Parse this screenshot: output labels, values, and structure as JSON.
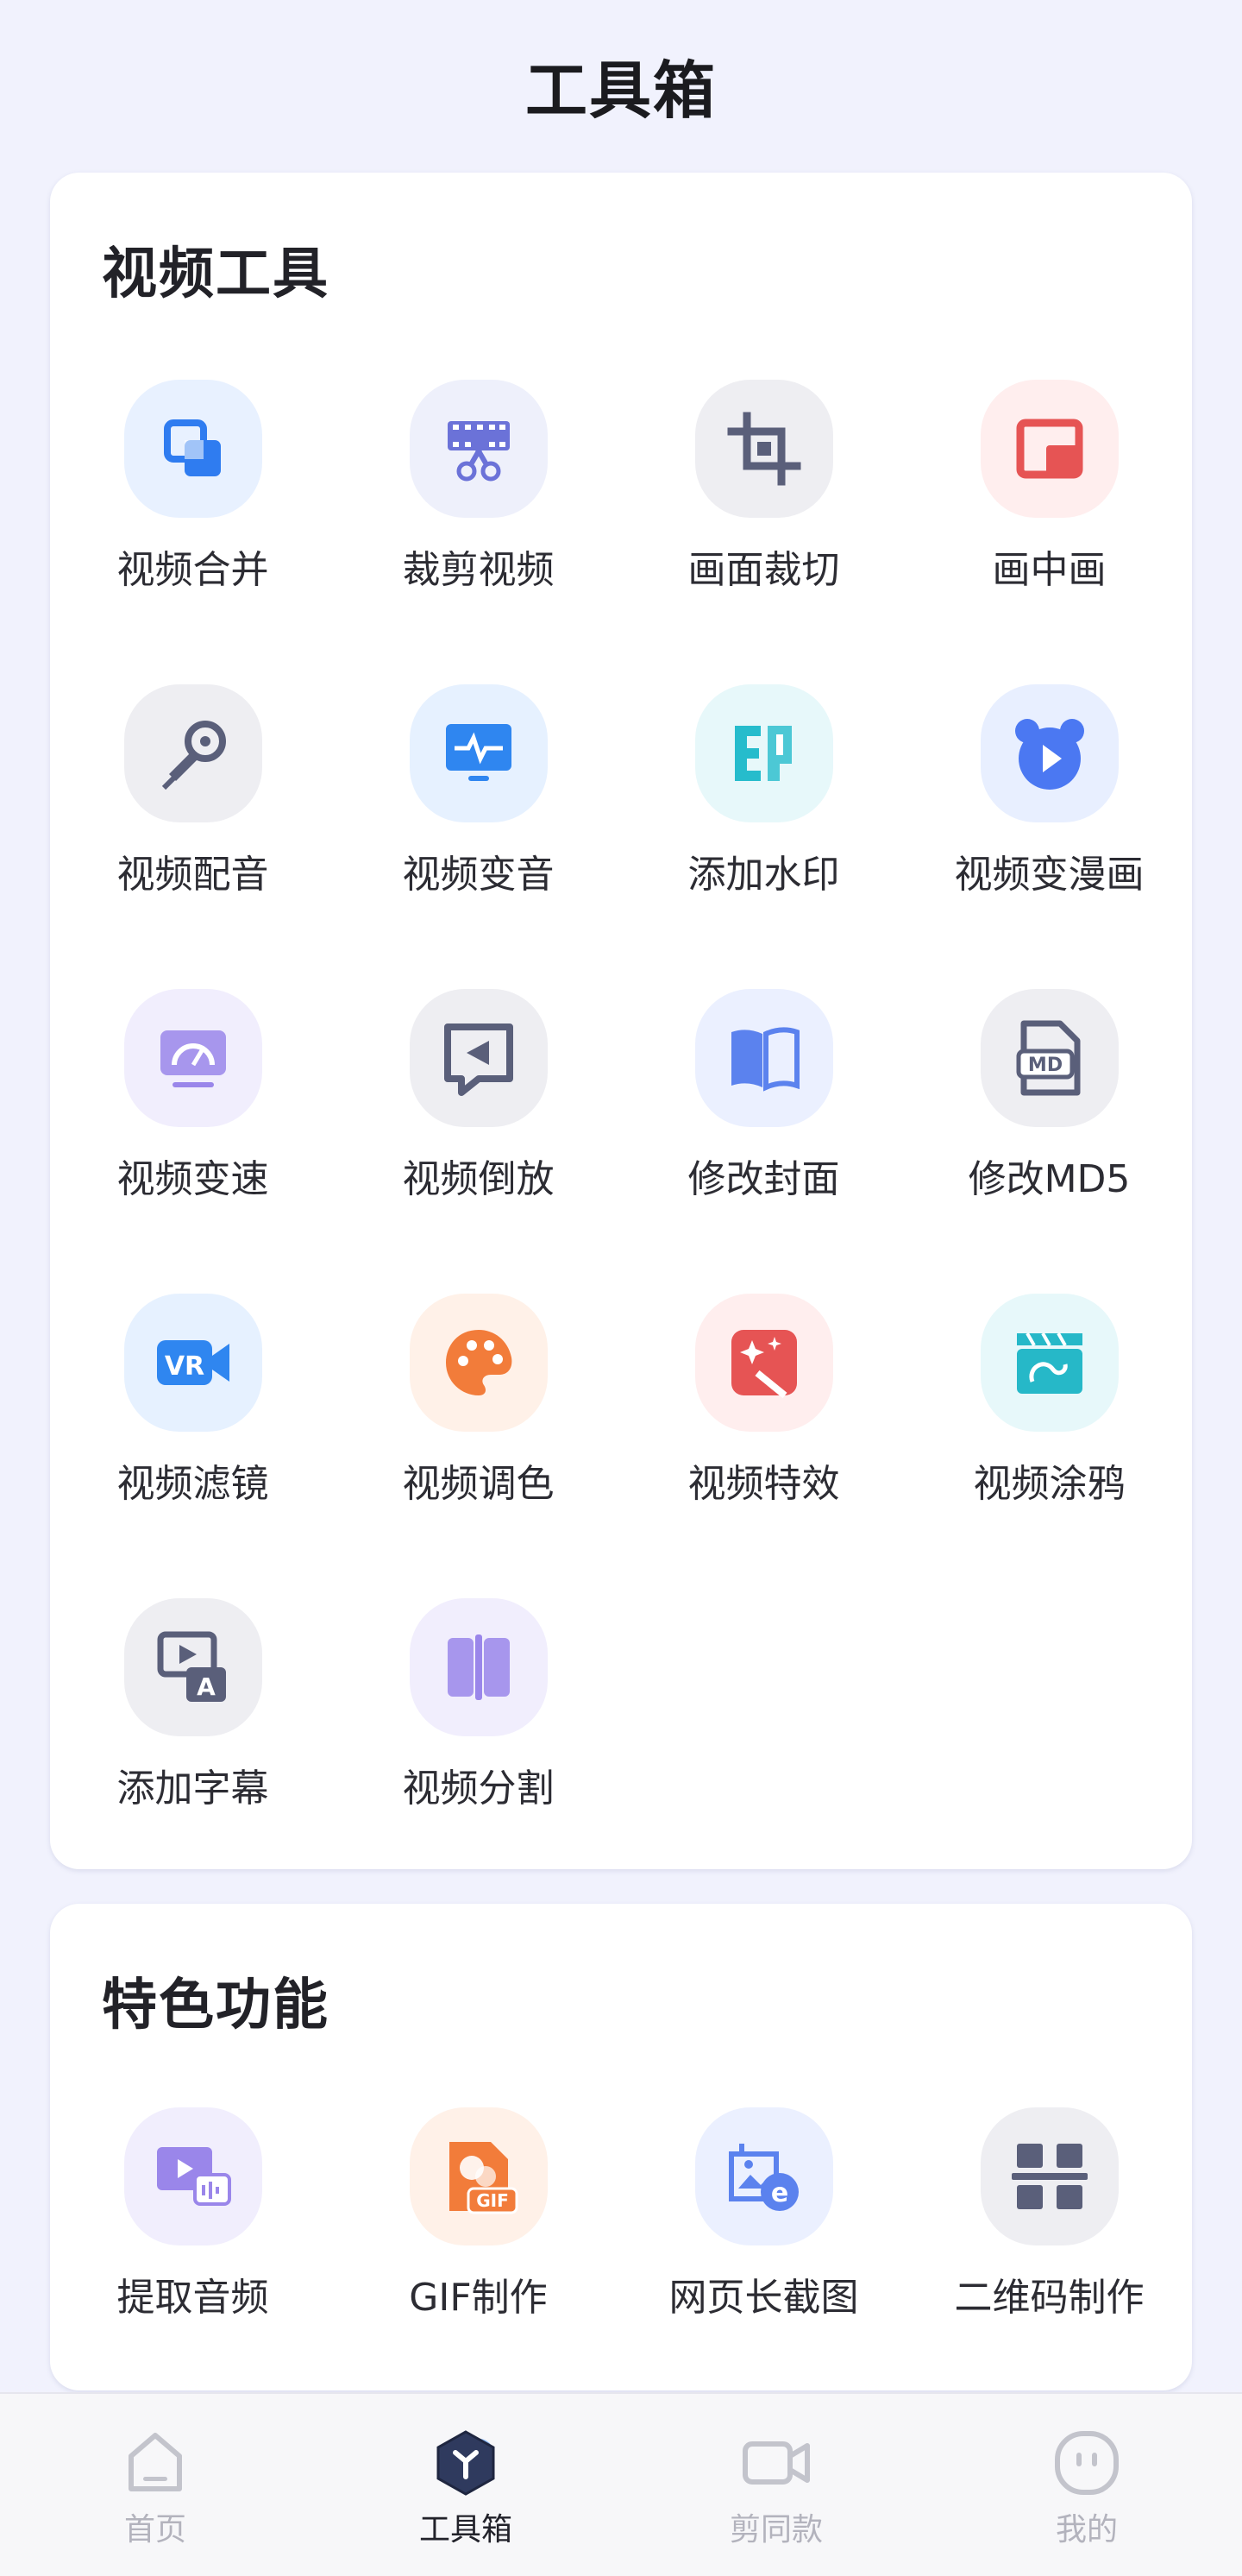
{
  "header": {
    "title": "工具箱"
  },
  "video_tools": {
    "title": "视频工具",
    "items": [
      {
        "label": "视频合并",
        "icon": "merge-icon",
        "bg": "#e8f1ff",
        "color": "#2f7cf0"
      },
      {
        "label": "裁剪视频",
        "icon": "scissors-film-icon",
        "bg": "#eef0fb",
        "color": "#6b72d8"
      },
      {
        "label": "画面裁切",
        "icon": "crop-icon",
        "bg": "#eeeef2",
        "color": "#5a5f7a"
      },
      {
        "label": "画中画",
        "icon": "picture-in-picture-icon",
        "bg": "#ffeeee",
        "color": "#e65454"
      },
      {
        "label": "视频配音",
        "icon": "microphone-icon",
        "bg": "#eeeef2",
        "color": "#5a5f7a"
      },
      {
        "label": "视频变音",
        "icon": "audio-monitor-icon",
        "bg": "#e6f1ff",
        "color": "#2f86f0"
      },
      {
        "label": "添加水印",
        "icon": "watermark-stamp-icon",
        "bg": "#e7f8fa",
        "color": "#26bccc"
      },
      {
        "label": "视频变漫画",
        "icon": "bear-play-icon",
        "bg": "#e8efff",
        "color": "#4b78f2"
      },
      {
        "label": "视频变速",
        "icon": "speed-gauge-icon",
        "bg": "#f1eefd",
        "color": "#9a86ea"
      },
      {
        "label": "视频倒放",
        "icon": "reverse-play-icon",
        "bg": "#eeeef2",
        "color": "#5a5f7a"
      },
      {
        "label": "修改封面",
        "icon": "book-cover-icon",
        "bg": "#ebf0ff",
        "color": "#5b82ee"
      },
      {
        "label": "修改MD5",
        "icon": "md5-file-icon",
        "bg": "#eeeef2",
        "color": "#5a5f7a"
      },
      {
        "label": "视频滤镜",
        "icon": "vr-camera-icon",
        "bg": "#e6f1ff",
        "color": "#2f86f0"
      },
      {
        "label": "视频调色",
        "icon": "palette-icon",
        "bg": "#fff1e8",
        "color": "#f27c3a"
      },
      {
        "label": "视频特效",
        "icon": "magic-wand-icon",
        "bg": "#ffeeee",
        "color": "#e65454"
      },
      {
        "label": "视频涂鸦",
        "icon": "clapperboard-doodle-icon",
        "bg": "#e7f8fa",
        "color": "#26b8c8"
      },
      {
        "label": "添加字幕",
        "icon": "subtitle-icon",
        "bg": "#eeeef2",
        "color": "#5a5f7a"
      },
      {
        "label": "视频分割",
        "icon": "split-icon",
        "bg": "#f1eefd",
        "color": "#9a86ea"
      }
    ]
  },
  "featured": {
    "title": "特色功能",
    "items": [
      {
        "label": "提取音频",
        "icon": "extract-audio-icon",
        "bg": "#f1eefd",
        "color": "#9a86ea"
      },
      {
        "label": "GIF制作",
        "icon": "gif-icon",
        "bg": "#fff1e8",
        "color": "#f27c3a",
        "badge": "GIF"
      },
      {
        "label": "网页长截图",
        "icon": "webpage-screenshot-icon",
        "bg": "#ebf0ff",
        "color": "#5b82ee"
      },
      {
        "label": "二维码制作",
        "icon": "qr-code-icon",
        "bg": "#eeeef2",
        "color": "#5a5f7a"
      }
    ]
  },
  "bottom_nav": {
    "items": [
      {
        "label": "首页",
        "icon": "home-icon",
        "active": false
      },
      {
        "label": "工具箱",
        "icon": "toolbox-hex-icon",
        "active": true
      },
      {
        "label": "剪同款",
        "icon": "video-camera-icon",
        "active": false
      },
      {
        "label": "我的",
        "icon": "profile-face-icon",
        "active": false
      }
    ]
  }
}
